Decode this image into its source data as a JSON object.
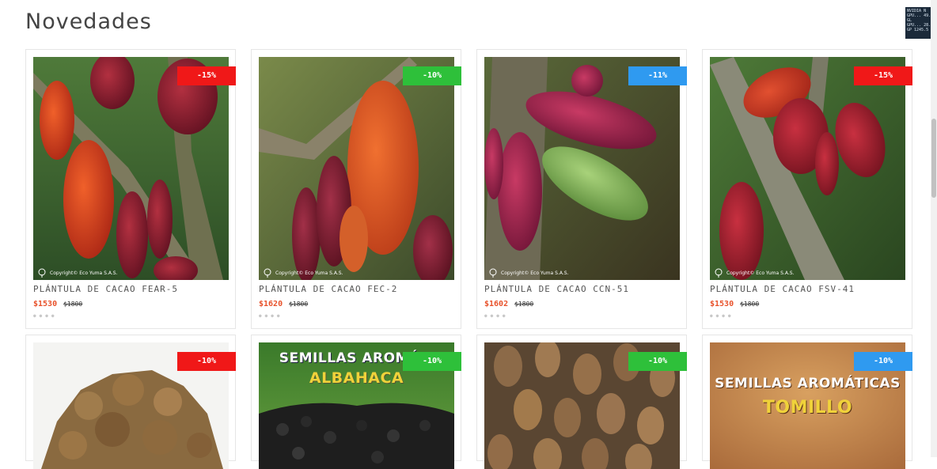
{
  "section": {
    "title": "Novedades"
  },
  "products": [
    {
      "title": "PLÁNTULA DE CACAO FEAR-5",
      "price": "$1530",
      "old_price": "$1800",
      "discount": "-15%",
      "badge_color": "#f01818",
      "copyright": "Copyright© Eco Yuma S.A.S."
    },
    {
      "title": "PLÁNTULA DE CACAO FEC-2",
      "price": "$1620",
      "old_price": "$1800",
      "discount": "-10%",
      "badge_color": "#2ec03a",
      "copyright": "Copyright© Eco Yuma S.A.S."
    },
    {
      "title": "PLÁNTULA DE CACAO CCN-51",
      "price": "$1602",
      "old_price": "$1800",
      "discount": "-11%",
      "badge_color": "#2f9af0",
      "copyright": "Copyright© Eco Yuma S.A.S."
    },
    {
      "title": "PLÁNTULA DE CACAO FSV-41",
      "price": "$1530",
      "old_price": "$1800",
      "discount": "-15%",
      "badge_color": "#f01818",
      "copyright": "Copyright© Eco Yuma S.A.S."
    },
    {
      "discount": "-10%",
      "badge_color": "#f01818"
    },
    {
      "discount": "-10%",
      "badge_color": "#2ec03a",
      "image_text_1": "SEMILLAS AROMÁTI",
      "image_text_2": "ALBAHACA"
    },
    {
      "discount": "-10%",
      "badge_color": "#2ec03a"
    },
    {
      "discount": "-10%",
      "badge_color": "#2f9af0",
      "image_text_1": "SEMILLAS AROMÁTICAS",
      "image_text_2": "TOMILLO"
    }
  ],
  "overlay": {
    "gpu_lines": [
      "NVIDIA N",
      "GPU... 49.0",
      "GL",
      "GPU... 28.2",
      "GP 1245.5 M"
    ]
  }
}
